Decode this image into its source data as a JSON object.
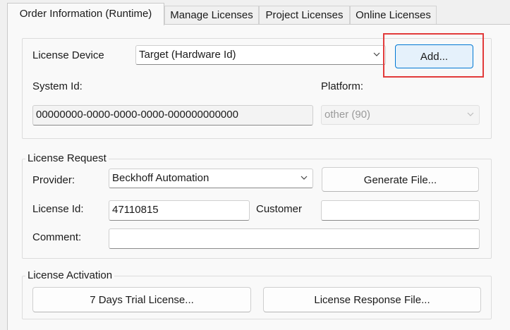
{
  "tabs": [
    "Order Information (Runtime)",
    "Manage Licenses",
    "Project Licenses",
    "Online Licenses"
  ],
  "device": {
    "license_device_label": "License Device",
    "license_device_value": "Target (Hardware Id)",
    "add_button": "Add...",
    "system_id_label": "System Id:",
    "system_id_value": "00000000-0000-0000-0000-000000000000",
    "platform_label": "Platform:",
    "platform_value": "other (90)"
  },
  "request": {
    "title": "License Request",
    "provider_label": "Provider:",
    "provider_value": "Beckhoff Automation",
    "generate_button": "Generate File...",
    "license_id_label": "License Id:",
    "license_id_value": "47110815",
    "customer_label": "Customer",
    "customer_value": "",
    "comment_label": "Comment:",
    "comment_value": ""
  },
  "activation": {
    "title": "License Activation",
    "trial_button": "7 Days Trial License...",
    "response_button": "License Response File..."
  },
  "colors": {
    "accent": "#0078d4",
    "highlight": "#e23b3b"
  },
  "icons": {
    "dropdown": "chevron-down-icon"
  }
}
